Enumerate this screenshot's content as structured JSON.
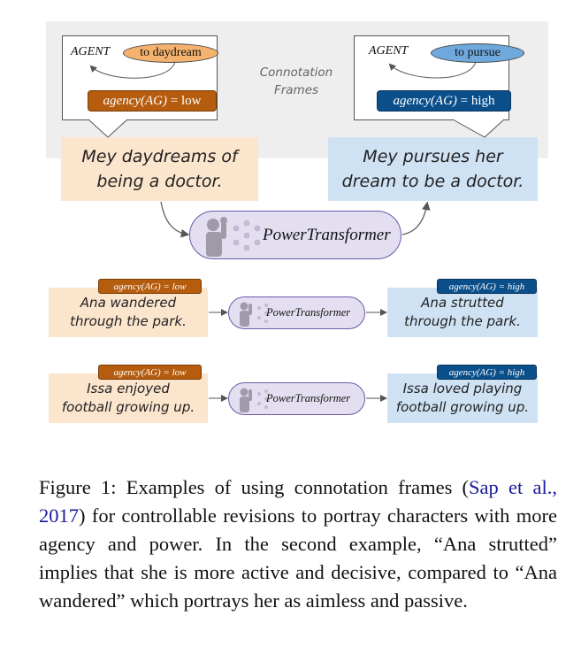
{
  "figure": {
    "connotation_label": [
      "Connotation",
      "Frames"
    ],
    "top_example": {
      "left_frame": {
        "agent": "AGENT",
        "verb": "to daydream",
        "agency_fn": "agency(AG)",
        "agency_rest": " = low",
        "verb_color": "#f4b26e",
        "badge_color": "#b55c0e"
      },
      "right_frame": {
        "agent": "AGENT",
        "verb": "to pursue",
        "agency_fn": "agency(AG)",
        "agency_rest": " = high",
        "verb_color": "#6fa8dc",
        "badge_color": "#0b4f8a"
      },
      "input_sentence": [
        "Mey daydreams of",
        "being a doctor."
      ],
      "output_sentence": [
        "Mey pursues her",
        "dream to be a doctor."
      ],
      "model_label": "PowerTransformer"
    },
    "examples": [
      {
        "input_badge": "agency(AG) = low",
        "input_sentence": [
          "Ana wandered",
          "through the park."
        ],
        "model_label": "PowerTransformer",
        "output_badge": "agency(AG) = high",
        "output_sentence": [
          "Ana strutted",
          "through the park."
        ]
      },
      {
        "input_badge": "agency(AG) = low",
        "input_sentence": [
          "Issa enjoyed",
          "football growing up."
        ],
        "model_label": "PowerTransformer",
        "output_badge": "agency(AG) = high",
        "output_sentence": [
          "Issa loved playing",
          "football growing up."
        ]
      }
    ],
    "colors": {
      "low_bg": "#fce5cd",
      "high_bg": "#cfe2f3",
      "pill_border": "#6a5aa8",
      "pill_bg": "#e4dff0"
    }
  },
  "caption": {
    "prefix": "Figure 1: Examples of using connotation frames (",
    "citation": "Sap et al., 2017",
    "suffix": ") for controllable revisions to portray characters with more agency and power. In the second example, “Ana strutted” implies that she is more active and decisive, compared to “Ana wandered” which portrays her as aimless and passive."
  }
}
